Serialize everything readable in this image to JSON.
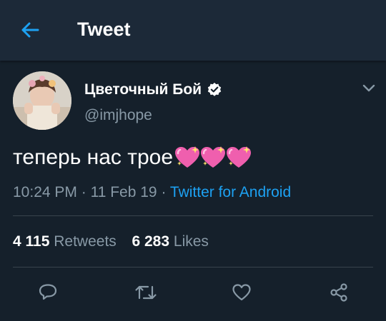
{
  "appbar": {
    "title": "Tweet",
    "back_icon": "arrow-left-icon"
  },
  "tweet": {
    "display_name": "Цветочный Бой",
    "verified_icon": "verified-badge-icon",
    "handle": "@imjhope",
    "text": "теперь нас трое",
    "emoji_icons": [
      "sparkling-heart-icon",
      "sparkling-heart-icon",
      "sparkling-heart-icon"
    ],
    "time": "10:24 PM",
    "date": "11 Feb 19",
    "separator": "·",
    "source": "Twitter for Android",
    "retweet_count": "4 115",
    "retweet_label": "Retweets",
    "like_count": "6 283",
    "like_label": "Likes"
  },
  "actions": [
    "reply-icon",
    "retweet-icon",
    "like-icon",
    "share-icon"
  ],
  "colors": {
    "background": "#15202b",
    "appbar": "#1c2938",
    "accent": "#1da1f2",
    "secondary_text": "#8899a6",
    "divider": "#38444d"
  }
}
